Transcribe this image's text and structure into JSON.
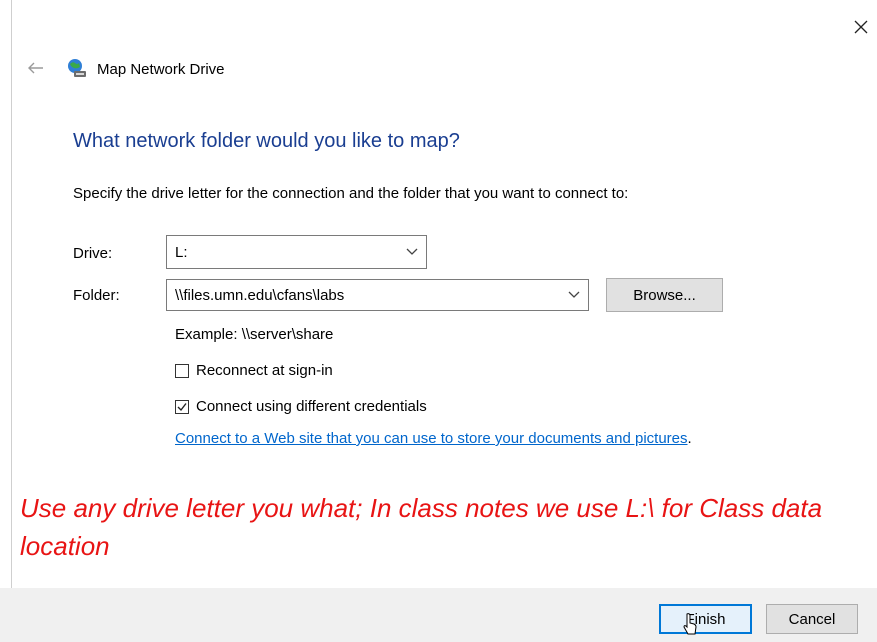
{
  "dialog": {
    "title": "Map Network Drive",
    "heading": "What network folder would you like to map?",
    "instruction": "Specify the drive letter for the connection and the folder that you want to connect to:"
  },
  "form": {
    "drive_label": "Drive:",
    "drive_value": "L:",
    "folder_label": "Folder:",
    "folder_value": "\\\\files.umn.edu\\cfans\\labs",
    "browse_label": "Browse...",
    "example": "Example: \\\\server\\share",
    "reconnect": {
      "label": "Reconnect at sign-in",
      "checked": false
    },
    "credentials": {
      "label": "Connect using different credentials",
      "checked": true
    },
    "link_text": "Connect to a Web site that you can use to store your documents and pictures",
    "link_suffix": "."
  },
  "annotation": "Use any drive letter you what; In class notes we use L:\\  for Class data location",
  "buttons": {
    "finish": "Finish",
    "cancel": "Cancel"
  },
  "icons": {
    "close": "close-icon",
    "back": "back-arrow-icon",
    "dialog": "network-drive-icon",
    "dropdown": "chevron-down-icon",
    "checkbox_check": "checkmark-icon",
    "cursor": "mouse-cursor-icon"
  },
  "colors": {
    "heading": "#1a3e91",
    "link": "#0066cc",
    "annotation": "#e81414",
    "primary_border": "#0078d7",
    "footer": "#f0f0f0"
  }
}
